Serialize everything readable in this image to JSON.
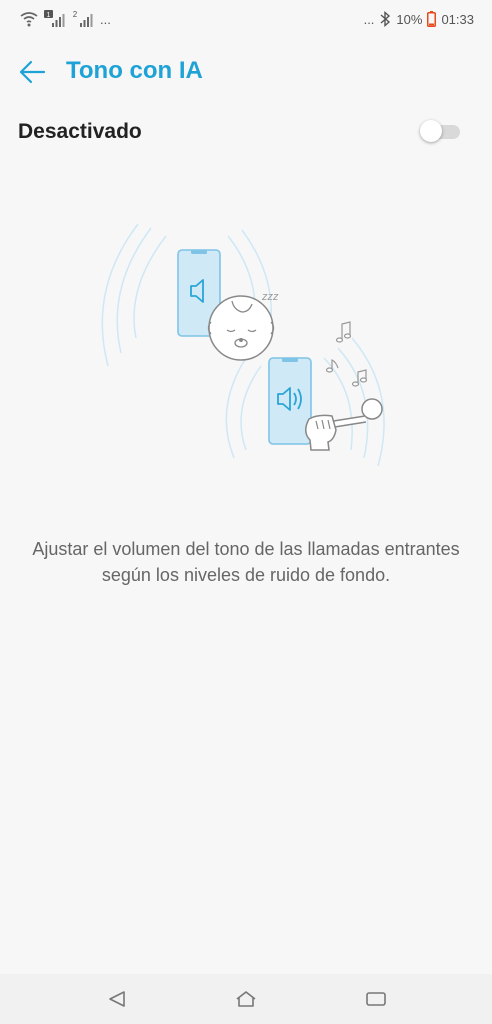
{
  "status_bar": {
    "left_more": "...",
    "right_more": "...",
    "battery_percent": "10%",
    "time": "01:33",
    "sim1_label": "1",
    "sim2_label": "2",
    "icons": [
      "wifi-icon",
      "signal-icon",
      "bluetooth-icon",
      "battery-icon"
    ]
  },
  "header": {
    "title": "Tono con IA"
  },
  "toggle": {
    "label": "Desactivado",
    "state": "off"
  },
  "illustration": {
    "icons": [
      "phone-icon",
      "speaker-icon",
      "sleeping-baby-icon",
      "music-notes-icon",
      "microphone-icon"
    ],
    "snore_text": "zzz"
  },
  "description": "Ajustar el volumen del tono de las llamadas entrantes según los niveles de ruido de fondo.",
  "nav_bar": {
    "icons": [
      "back-triangle-icon",
      "home-icon",
      "recents-icon"
    ]
  },
  "colors": {
    "accent": "#1fa3d6",
    "illustration_blue": "#bfe3f3"
  }
}
